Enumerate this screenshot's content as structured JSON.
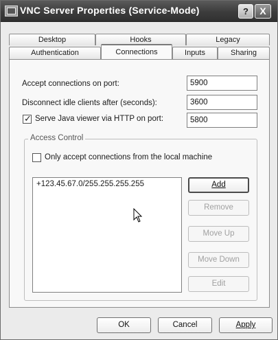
{
  "window": {
    "title": "VNC Server Properties (Service-Mode)",
    "help_label": "?",
    "close_label": "X"
  },
  "tabs": {
    "row1": [
      "Desktop",
      "Hooks",
      "Legacy"
    ],
    "row2": [
      "Authentication",
      "Connections",
      "Inputs",
      "Sharing"
    ],
    "active": "Connections"
  },
  "connections": {
    "accept_port_label": "Accept connections on port:",
    "accept_port_value": "5900",
    "idle_label": "Disconnect idle clients after (seconds):",
    "idle_value": "3600",
    "http_label": "Serve Java viewer via HTTP on port:",
    "http_checked": true,
    "http_value": "5800"
  },
  "access_control": {
    "group_title": "Access Control",
    "local_only_label": "Only accept connections from the local machine",
    "local_only_checked": false,
    "entries": [
      "+123.45.67.0/255.255.255.255"
    ],
    "buttons": {
      "add": "Add",
      "remove": "Remove",
      "move_up": "Move Up",
      "move_down": "Move Down",
      "edit": "Edit"
    }
  },
  "footer": {
    "ok": "OK",
    "cancel": "Cancel",
    "apply": "Apply"
  },
  "icons": {
    "check": "✓",
    "cursor": "arrow-pointer"
  }
}
